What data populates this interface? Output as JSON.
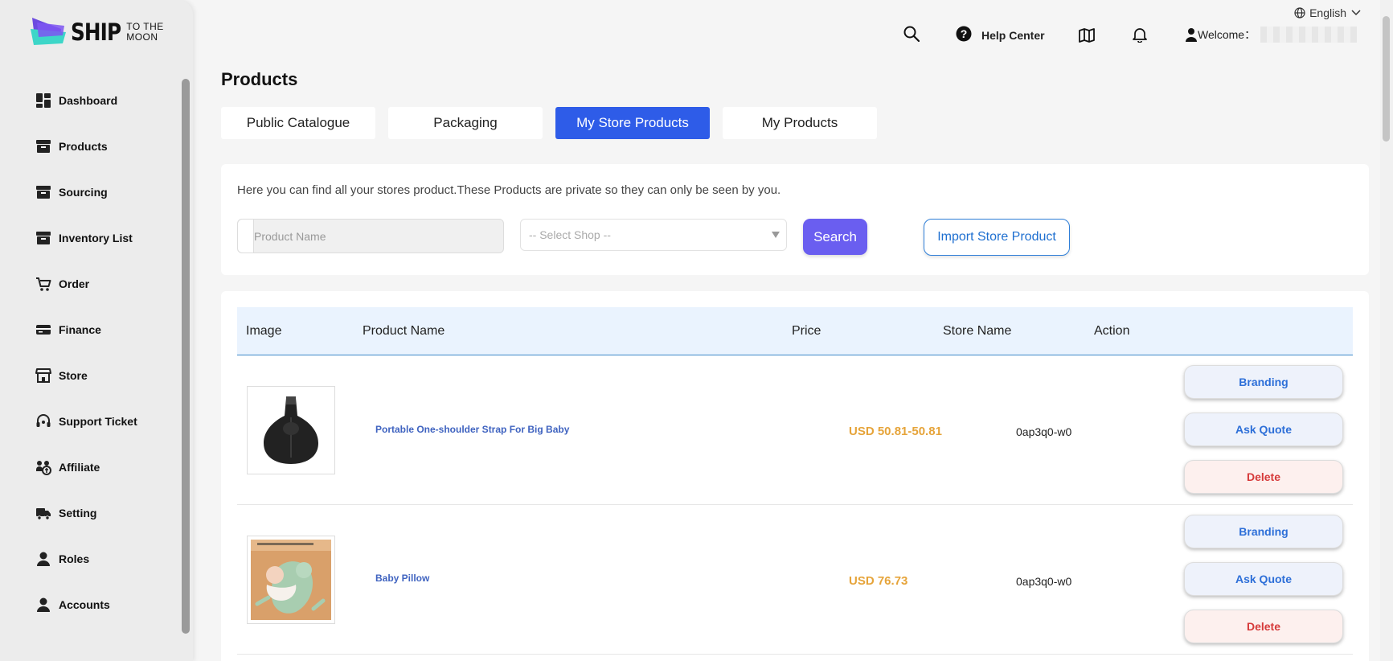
{
  "brand": {
    "main": "SHIP",
    "small_top": "TO THE",
    "small_bottom": "MOON"
  },
  "sidebar": {
    "items": [
      {
        "label": "Dashboard",
        "icon": "dashboard-icon"
      },
      {
        "label": "Products",
        "icon": "box-icon"
      },
      {
        "label": "Sourcing",
        "icon": "box-icon"
      },
      {
        "label": "Inventory List",
        "icon": "box-icon"
      },
      {
        "label": "Order",
        "icon": "cart-icon"
      },
      {
        "label": "Finance",
        "icon": "card-icon"
      },
      {
        "label": "Store",
        "icon": "store-icon"
      },
      {
        "label": "Support Ticket",
        "icon": "headset-icon"
      },
      {
        "label": "Affiliate",
        "icon": "affiliate-icon"
      },
      {
        "label": "Setting",
        "icon": "truck-icon"
      },
      {
        "label": "Roles",
        "icon": "user-icon"
      },
      {
        "label": "Accounts",
        "icon": "user-icon"
      }
    ]
  },
  "header": {
    "language": "English",
    "help_label": "Help Center",
    "welcome_label": "Welcome："
  },
  "page": {
    "title": "Products",
    "tabs": [
      "Public Catalogue",
      "Packaging",
      "My Store Products",
      "My Products"
    ],
    "active_tab": "My Store Products"
  },
  "filters": {
    "description": "Here you can find all your stores product.These Products are private so they can only be seen by you.",
    "product_name_placeholder": "Product Name",
    "shop_placeholder": "-- Select Shop --",
    "search_label": "Search",
    "import_label": "Import Store Product"
  },
  "table": {
    "headers": [
      "Image",
      "Product Name",
      "Price",
      "Store Name",
      "Action"
    ],
    "rows": [
      {
        "name": "Portable One-shoulder Strap For Big Baby",
        "price": "USD 50.81-50.81",
        "store": "0ap3q0-w0",
        "actions": [
          "Branding",
          "Ask Quote",
          "Delete"
        ]
      },
      {
        "name": "Baby Pillow",
        "price": "USD 76.73",
        "store": "0ap3q0-w0",
        "actions": [
          "Branding",
          "Ask Quote",
          "Delete"
        ]
      }
    ]
  },
  "colors": {
    "accent": "#2e5ce8",
    "search": "#6a5ef0",
    "price": "#e6a43a",
    "delete": "#d63a3a",
    "link": "#3f63c0"
  }
}
